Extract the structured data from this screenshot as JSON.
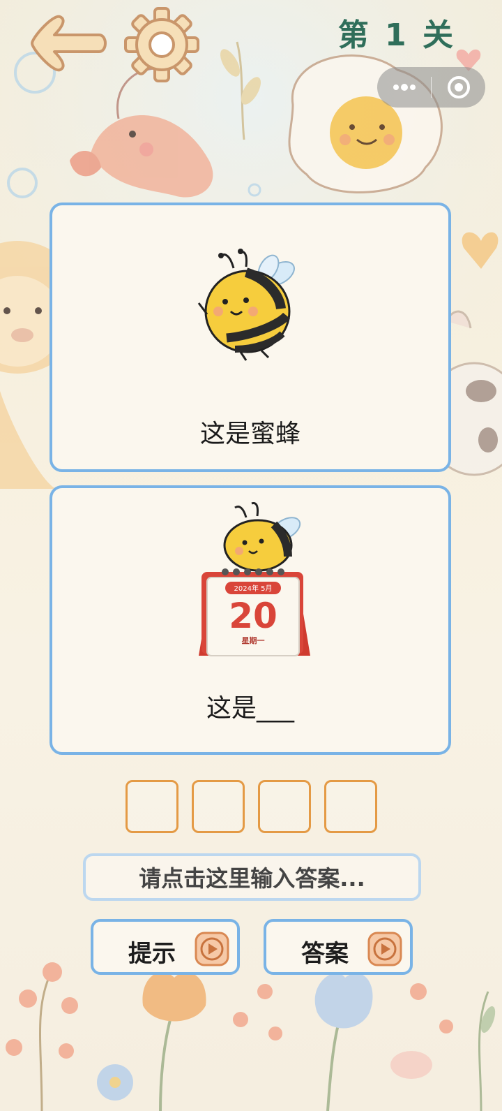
{
  "header": {
    "back_icon": "arrow-left-icon",
    "settings_icon": "gear-icon",
    "level_title": "第 1 关",
    "capsule": {
      "more_icon": "more-dots-icon",
      "close_icon": "target-circle-icon"
    }
  },
  "cards": [
    {
      "image_icon": "bee-icon",
      "text": "这是蜜蜂"
    },
    {
      "image_icon": "bee-on-calendar-icon",
      "text": "这是___",
      "calendar": {
        "header": "2024年 5月",
        "day": "20",
        "weekday": "星期一"
      }
    }
  ],
  "answer": {
    "slots": [
      "",
      "",
      "",
      ""
    ],
    "input_label": "请点击这里输入答案..."
  },
  "buttons": {
    "hint_label": "提示",
    "answer_label": "答案",
    "play_icon": "play-icon"
  },
  "colors": {
    "accent_blue": "#79b3e6",
    "slot_orange": "#e49a45",
    "title_green": "#2f6e5a",
    "calendar_red": "#d63a2f"
  }
}
